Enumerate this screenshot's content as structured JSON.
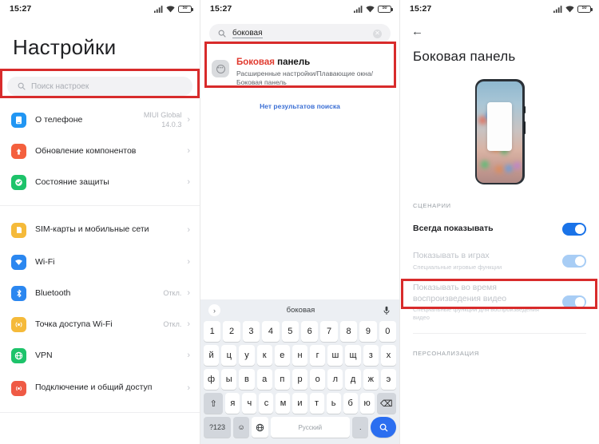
{
  "status": {
    "time": "15:27",
    "battery_label": "50"
  },
  "left": {
    "title": "Настройки",
    "search_placeholder": "Поиск настроек",
    "search_icon": "search-icon",
    "items": [
      {
        "label": "О телефоне",
        "value": "MIUI Global\n14.0.3",
        "icon": "phone-icon",
        "color": "#2196f3",
        "chevron": "›"
      },
      {
        "label": "Обновление компонентов",
        "value": "",
        "icon": "update-arrow-icon",
        "color": "#f4603e",
        "chevron": "›"
      },
      {
        "label": "Состояние защиты",
        "value": "",
        "icon": "shield-check-icon",
        "color": "#1dc36a",
        "chevron": "›"
      },
      {
        "label": "SIM-карты и мобильные сети",
        "value": "",
        "icon": "sim-card-icon",
        "color": "#f5ba3a",
        "chevron": "›"
      },
      {
        "label": "Wi-Fi",
        "value": "",
        "icon": "wifi-icon",
        "color": "#2b87f0",
        "chevron": "›"
      },
      {
        "label": "Bluetooth",
        "value": "Откл.",
        "icon": "bluetooth-icon",
        "color": "#2b87f0",
        "chevron": "›"
      },
      {
        "label": "Точка доступа Wi-Fi",
        "value": "Откл.",
        "icon": "hotspot-icon",
        "color": "#f5ba3a",
        "chevron": "›"
      },
      {
        "label": "VPN",
        "value": "",
        "icon": "globe-icon",
        "color": "#1dc36a",
        "chevron": "›"
      },
      {
        "label": "Подключение и общий доступ",
        "value": "",
        "icon": "share-icon",
        "color": "#ef5a45",
        "chevron": "›"
      }
    ]
  },
  "middle": {
    "search_query": "боковая",
    "search_icon": "search-icon",
    "clear_icon": "close-icon",
    "clear_glyph": "✕",
    "result": {
      "title_highlight": "Боковая",
      "title_rest": " панель",
      "subtitle": "Расширенные настройки/Плавающие окна/\nБоковая панель",
      "icon": "side-panel-icon"
    },
    "no_results": "Нет результатов поиска",
    "keyboard": {
      "suggestion": "боковая",
      "expand_icon": "chevron-right-icon",
      "expand_glyph": "›",
      "mic_icon": "microphone-icon",
      "row_numbers": [
        "1",
        "2",
        "3",
        "4",
        "5",
        "6",
        "7",
        "8",
        "9",
        "0"
      ],
      "row_1": [
        "й",
        "ц",
        "у",
        "к",
        "е",
        "н",
        "г",
        "ш",
        "щ",
        "з",
        "х"
      ],
      "row_2": [
        "ф",
        "ы",
        "в",
        "а",
        "п",
        "р",
        "о",
        "л",
        "д",
        "ж",
        "э"
      ],
      "row_3": [
        "я",
        "ч",
        "с",
        "м",
        "и",
        "т",
        "ь",
        "б",
        "ю"
      ],
      "shift_glyph": "⇧",
      "shift_icon": "shift-icon",
      "backspace_glyph": "⌫",
      "backspace_icon": "backspace-icon",
      "numeric_key": "?123",
      "emoji_glyph": "☺",
      "emoji_icon": "emoji-icon",
      "globe_glyph": "🌐",
      "globe_icon": "language-globe-icon",
      "space_label": "Русский",
      "dot_key": ".",
      "enter_icon": "search-enter-icon"
    }
  },
  "right": {
    "back_icon": "back-arrow-icon",
    "back_glyph": "←",
    "title": "Боковая панель",
    "preview_icon": "phone-preview-image",
    "section_scenarios": "СЦЕНАРИИ",
    "section_personalization": "ПЕРСОНАЛИЗАЦИЯ",
    "options": [
      {
        "title": "Всегда показывать",
        "subtitle": "",
        "toggle": "on",
        "dim": false
      },
      {
        "title": "Показывать в играх",
        "subtitle": "Специальные игровые функции",
        "toggle": "on-pale",
        "dim": true
      },
      {
        "title": "Показывать во время воспроизведения видео",
        "subtitle": "Специальные функции для воспроизведения видео",
        "toggle": "on-pale",
        "dim": true
      }
    ]
  },
  "annotations": {
    "highlight_color": "#d82b2b",
    "accent_blue": "#1a73e8",
    "link_blue": "#3b6fd4",
    "highlight_red_text": "#e03a2f"
  }
}
